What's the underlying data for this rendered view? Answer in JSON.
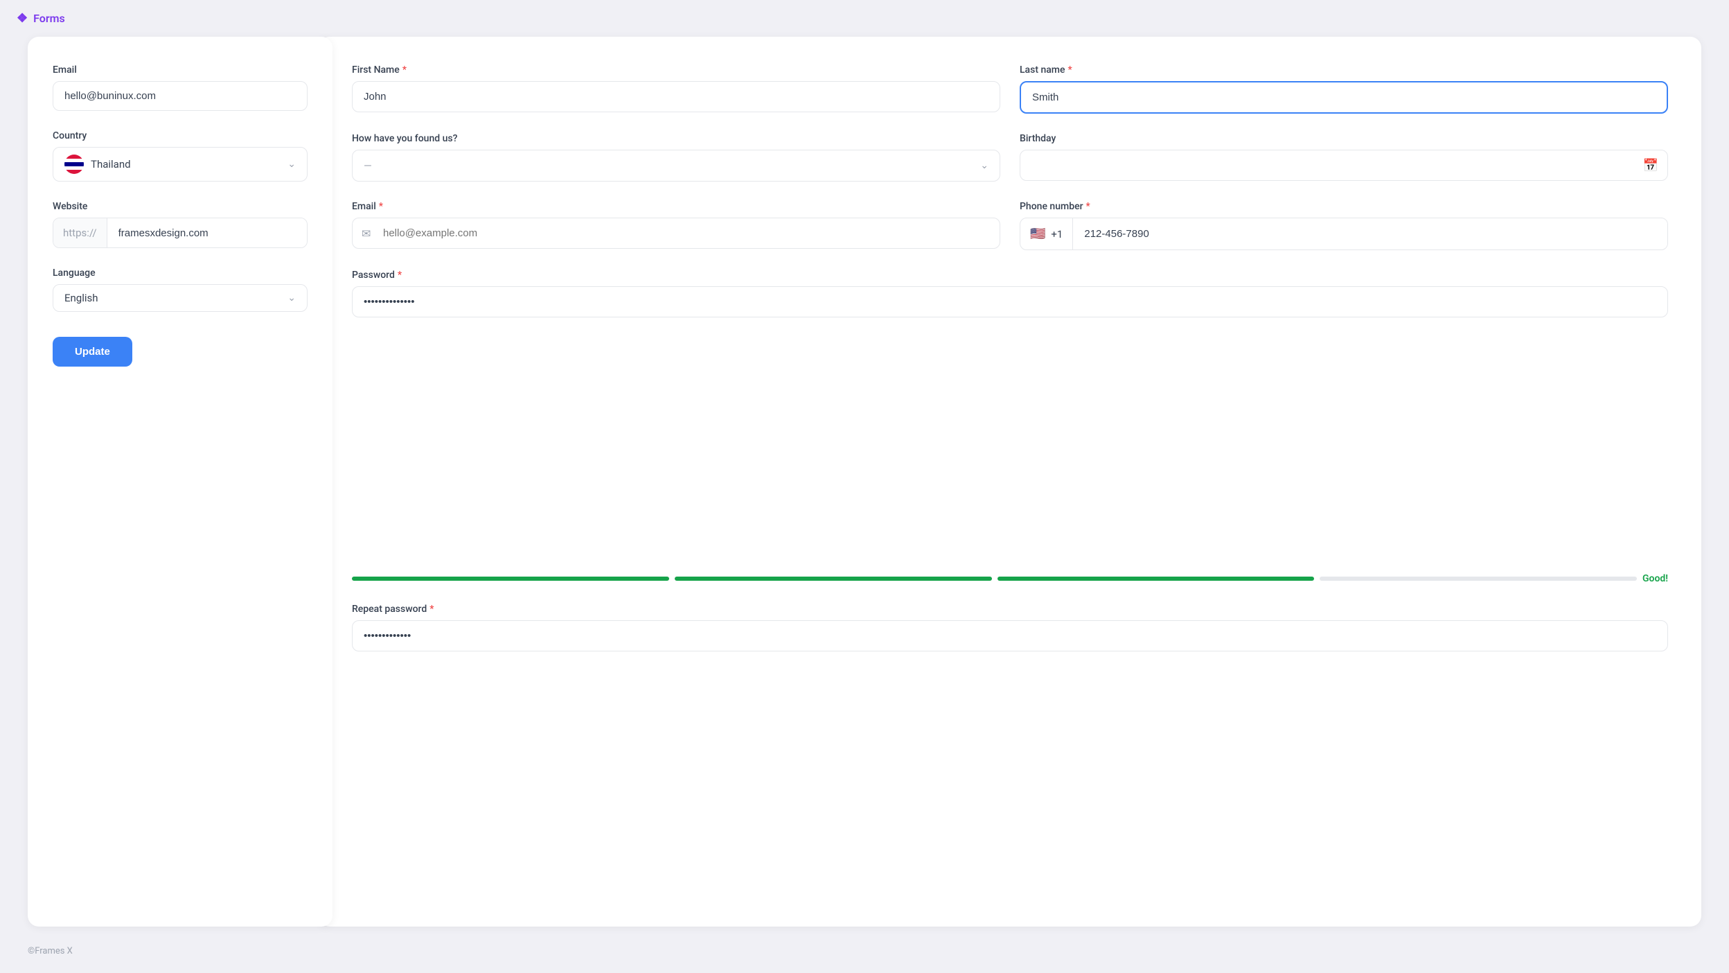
{
  "app": {
    "title": "Forms",
    "logo_icon": "❖",
    "footer": "©Frames X"
  },
  "left_form": {
    "email_label": "Email",
    "email_value": "hello@buninux.com",
    "country_label": "Country",
    "country_value": "Thailand",
    "country_flag": "🇹🇭",
    "website_label": "Website",
    "website_prefix": "https://",
    "website_value": "framesxdesign.com",
    "language_label": "Language",
    "language_value": "English",
    "update_button": "Update"
  },
  "right_form": {
    "first_name_label": "First Name",
    "first_name_value": "John",
    "last_name_label": "Last name",
    "last_name_value": "Smith",
    "how_found_label": "How have you found us?",
    "how_found_placeholder": "—",
    "birthday_label": "Birthday",
    "birthday_placeholder": "",
    "email_label": "Email",
    "email_placeholder": "hello@example.com",
    "phone_label": "Phone number",
    "phone_country_code": "+1",
    "phone_value": "212-456-7890",
    "password_label": "Password",
    "password_value": "••••••••••••",
    "password_strength_label": "Good!",
    "password_strength_bars": [
      {
        "filled": true
      },
      {
        "filled": true
      },
      {
        "filled": true
      },
      {
        "filled": false
      }
    ],
    "repeat_password_label": "Repeat password",
    "repeat_password_value": "•••••••••••"
  }
}
